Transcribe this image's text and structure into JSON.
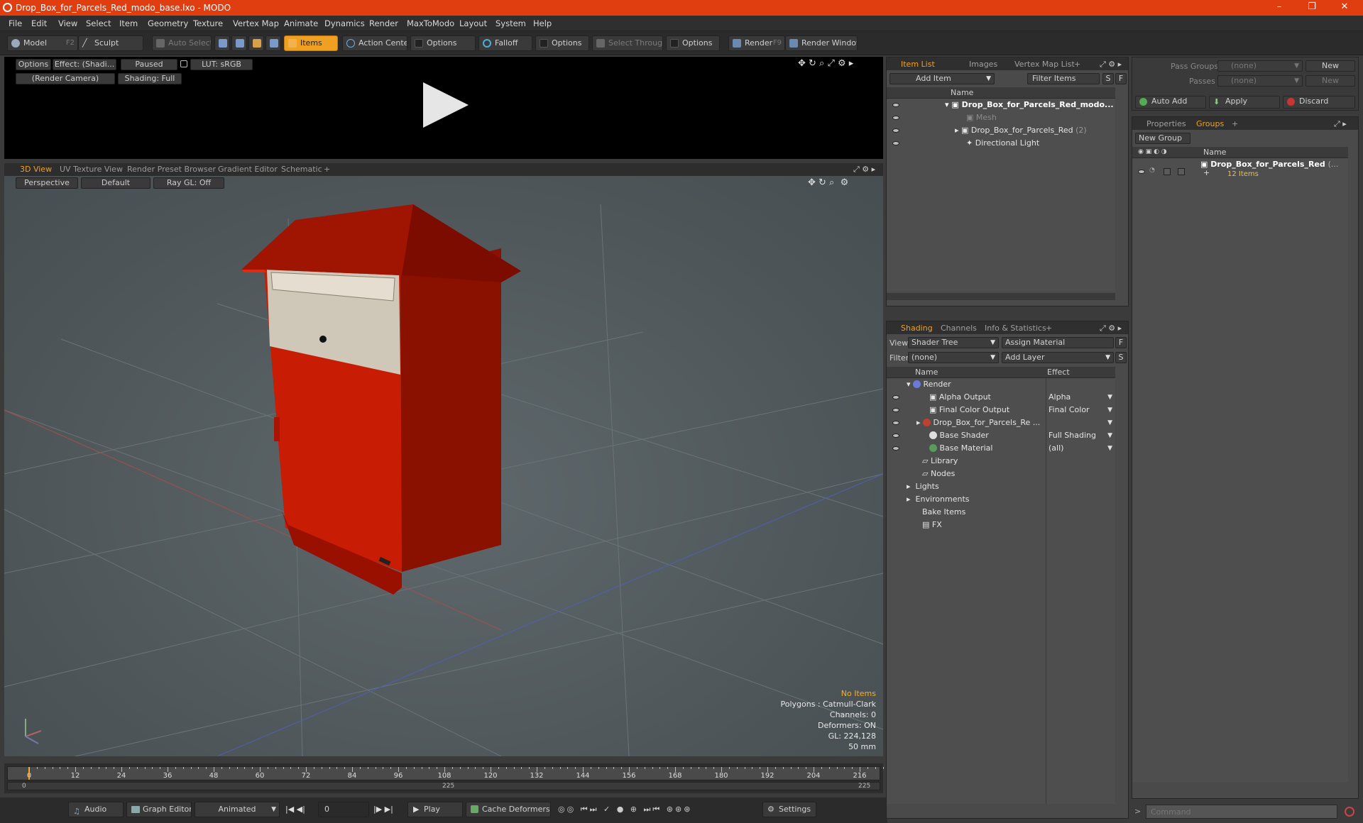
{
  "window": {
    "title": "Drop_Box_for_Parcels_Red_modo_base.lxo - MODO",
    "minimize": "–",
    "restore": "❐",
    "close": "✕"
  },
  "menu": [
    "File",
    "Edit",
    "View",
    "Select",
    "Item",
    "Geometry",
    "Texture",
    "Vertex Map",
    "Animate",
    "Dynamics",
    "Render",
    "MaxToModo",
    "Layout",
    "System",
    "Help"
  ],
  "toolbar": {
    "model": "Model",
    "model_key": "F2",
    "sculpt": "Sculpt",
    "auto_select": "Auto Select",
    "items": "Items",
    "action_center": "Action Center",
    "options1": "Options",
    "falloff": "Falloff",
    "options2": "Options",
    "select_through": "Select Through",
    "options3": "Options",
    "render": "Render",
    "render_key": "F9",
    "render_window": "Render Window"
  },
  "preview": {
    "options": "Options",
    "effect": "Effect: (Shadi...",
    "paused": "Paused",
    "lut": "LUT: sRGB",
    "camera": "(Render Camera)",
    "shading": "Shading: Full"
  },
  "view_tabs": [
    "3D View",
    "UV Texture View",
    "Render Preset Browser",
    "Gradient Editor",
    "Schematic",
    "+"
  ],
  "viewport": {
    "perspective": "Perspective",
    "default": "Default",
    "raygl": "Ray GL: Off",
    "hud": {
      "no_items": "No Items",
      "polygons": "Polygons : Catmull-Clark",
      "channels": "Channels: 0",
      "deformers": "Deformers: ON",
      "gl": "GL: 224,128",
      "mm": "50 mm"
    },
    "colors": {
      "red": "#cc1e05",
      "dark_red": "#8a1000",
      "roof": "#a01402",
      "panel": "#cfc7b8"
    }
  },
  "timeline": {
    "labels": [
      "0",
      "12",
      "24",
      "36",
      "48",
      "60",
      "72",
      "84",
      "96",
      "108",
      "120",
      "132",
      "144",
      "156",
      "168",
      "180",
      "192",
      "204",
      "216"
    ],
    "sub_start": "0",
    "sub_mid": "225",
    "sub_end": "225"
  },
  "bottombar": {
    "audio": "Audio",
    "graph_editor": "Graph Editor",
    "animated": "Animated",
    "frame": "0",
    "play": "Play",
    "cache_deformers": "Cache Deformers",
    "settings": "Settings"
  },
  "item_list": {
    "tabs": [
      "Item List",
      "Images",
      "Vertex Map List",
      "+"
    ],
    "add_item": "Add Item",
    "filter_items": "Filter Items",
    "s": "S",
    "f": "F",
    "name_col": "Name",
    "rows": [
      {
        "label": "Drop_Box_for_Parcels_Red_modo...",
        "count": ""
      },
      {
        "label": "Mesh",
        "count": ""
      },
      {
        "label": "Drop_Box_for_Parcels_Red",
        "count": "(2)"
      },
      {
        "label": "Directional Light",
        "count": ""
      }
    ]
  },
  "shading": {
    "tabs": [
      "Shading",
      "Channels",
      "Info & Statistics",
      "+"
    ],
    "view_label": "View",
    "view_value": "Shader Tree",
    "assign_material": "Assign Material",
    "filter_label": "Filter",
    "filter_value": "(none)",
    "add_layer": "Add Layer",
    "f": "F",
    "s": "S",
    "name_col": "Name",
    "effect_col": "Effect",
    "rows": [
      {
        "label": "Render",
        "effect": ""
      },
      {
        "label": "Alpha Output",
        "effect": "Alpha"
      },
      {
        "label": "Final Color Output",
        "effect": "Final Color"
      },
      {
        "label": "Drop_Box_for_Parcels_Re ...",
        "effect": ""
      },
      {
        "label": "Base Shader",
        "effect": "Full Shading"
      },
      {
        "label": "Base Material",
        "effect": "(all)"
      },
      {
        "label": "Library",
        "effect": ""
      },
      {
        "label": "Nodes",
        "effect": ""
      },
      {
        "label": "Lights",
        "effect": ""
      },
      {
        "label": "Environments",
        "effect": ""
      },
      {
        "label": "Bake Items",
        "effect": ""
      },
      {
        "label": "FX",
        "effect": ""
      }
    ]
  },
  "passes": {
    "pass_groups_label": "Pass Groups",
    "pass_groups_value": "(none)",
    "new1": "New",
    "passes_label": "Passes",
    "passes_value": "(none)",
    "new2": "New",
    "auto_add": "Auto Add",
    "apply": "Apply",
    "discard": "Discard"
  },
  "groups": {
    "tabs": [
      "Properties",
      "Groups",
      "+"
    ],
    "new_group": "New Group",
    "name_col": "Name",
    "group_name": "Drop_Box_for_Parcels_Red",
    "group_more": "(...",
    "group_items": "12 Items"
  },
  "command": {
    "placeholder": "Command"
  }
}
